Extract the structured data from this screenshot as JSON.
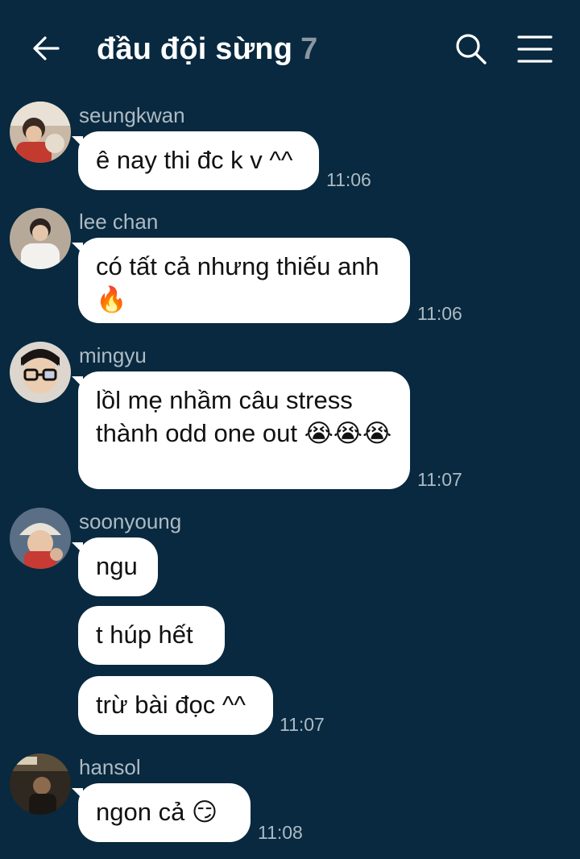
{
  "header": {
    "title": "đầu đội sừng",
    "member_count": "7",
    "back_icon": "arrow-left-icon",
    "search_icon": "search-icon",
    "menu_icon": "hamburger-menu-icon"
  },
  "colors": {
    "background": "#08293f",
    "bubble": "#ffffff",
    "meta_text": "#aebac3"
  },
  "messages": [
    {
      "sender": "seungkwan",
      "bubbles": [
        "ê nay thi đc k v ^^"
      ],
      "time": "11:06"
    },
    {
      "sender": "lee chan",
      "bubbles": [
        "có tất cả nhưng thiếu anh 🔥"
      ],
      "time": "11:06"
    },
    {
      "sender": "mingyu",
      "bubbles": [
        "lồl mẹ nhầm câu stress thành odd one out 😭😭😭"
      ],
      "time": "11:07"
    },
    {
      "sender": "soonyoung",
      "bubbles": [
        "ngu",
        "t húp hết",
        "trừ bài đọc ^^"
      ],
      "time": "11:07"
    },
    {
      "sender": "hansol",
      "bubbles": [
        "ngon cả 😏"
      ],
      "time": "11:08"
    }
  ]
}
